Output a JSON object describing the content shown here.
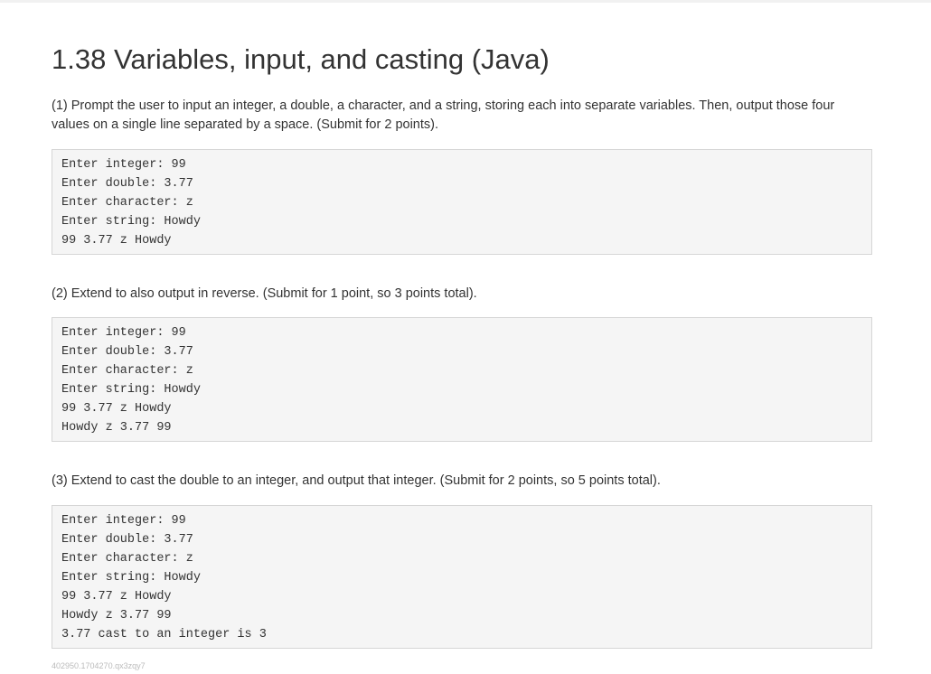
{
  "title": "1.38 Variables, input, and casting (Java)",
  "sections": [
    {
      "instruction": "(1) Prompt the user to input an integer, a double, a character, and a string, storing each into separate variables. Then, output those four values on a single line separated by a space. (Submit for 2 points).",
      "output_lines": [
        "Enter integer: 99",
        "Enter double: 3.77",
        "Enter character: z",
        "Enter string: Howdy",
        "99 3.77 z Howdy"
      ]
    },
    {
      "instruction": "(2) Extend to also output in reverse. (Submit for 1 point, so 3 points total).",
      "output_lines": [
        "Enter integer: 99",
        "Enter double: 3.77",
        "Enter character: z",
        "Enter string: Howdy",
        "99 3.77 z Howdy",
        "Howdy z 3.77 99"
      ]
    },
    {
      "instruction": "(3) Extend to cast the double to an integer, and output that integer. (Submit for 2 points, so 5 points total).",
      "output_lines": [
        "Enter integer: 99",
        "Enter double: 3.77",
        "Enter character: z",
        "Enter string: Howdy",
        "99 3.77 z Howdy",
        "Howdy z 3.77 99",
        "3.77 cast to an integer is 3"
      ]
    }
  ],
  "footer_id": "402950.1704270.qx3zqy7"
}
